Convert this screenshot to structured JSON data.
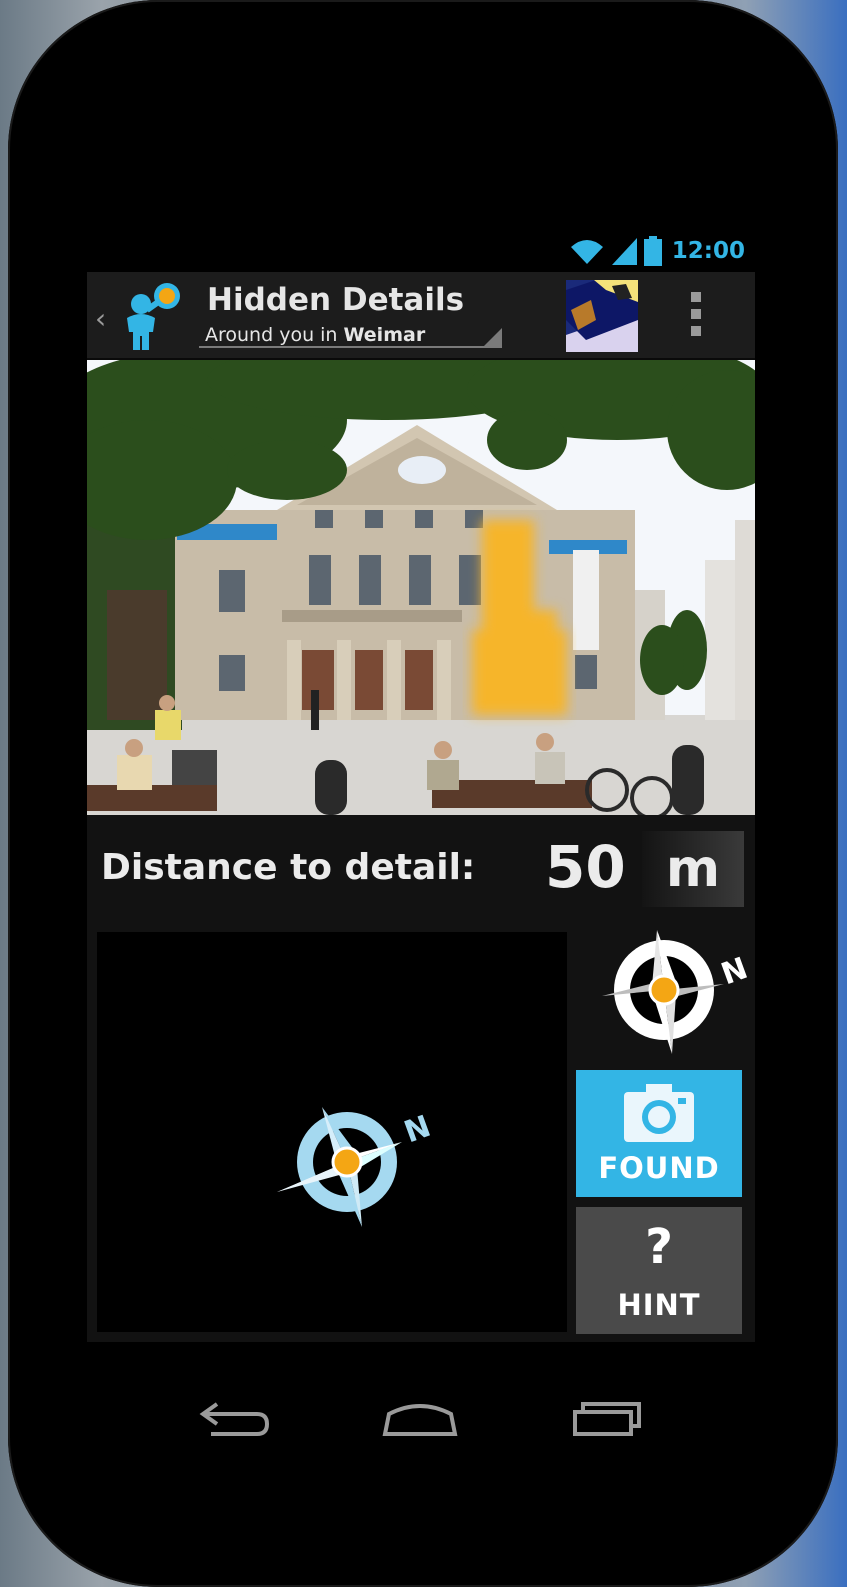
{
  "statusbar": {
    "time": "12:00"
  },
  "actionbar": {
    "title": "Hidden Details",
    "subtitle_prefix": "Around you in ",
    "subtitle_city": "Weimar"
  },
  "detail": {
    "distance_label": "Distance to detail:",
    "distance_value": "50",
    "distance_unit": "m"
  },
  "buttons": {
    "found_label": "FOUND",
    "hint_symbol": "?",
    "hint_label": "HINT"
  },
  "compass": {
    "north_letter": "N"
  },
  "icons": {
    "up": "chevron-left-icon",
    "app": "person-lightbulb-icon",
    "overflow": "overflow-menu-icon",
    "camera": "camera-icon",
    "wifi": "wifi-icon",
    "signal": "signal-icon",
    "battery": "battery-icon",
    "back": "back-icon",
    "home": "home-icon",
    "recents": "recents-icon"
  },
  "colors": {
    "accent": "#33b5e5",
    "compass_light": "#a5d9f0",
    "sun": "#f4a614"
  }
}
